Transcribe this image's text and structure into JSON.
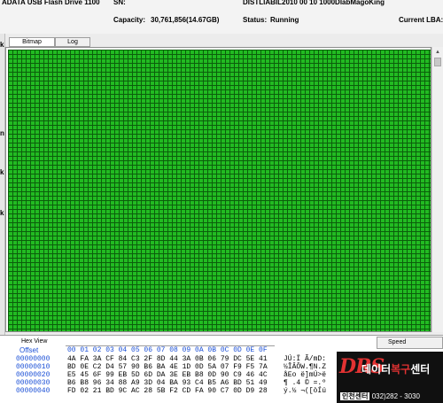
{
  "device": {
    "name": "ADATA   USB Flash Drive 1100",
    "sn_label": "SN:",
    "path_fragment": "DISTLIABIL2010 00 10 1000DlabMagoKing",
    "capacity_label": "Capacity:",
    "capacity_value": "30,761,856(14.67GB)",
    "status_label": "Status:",
    "status_value": "Running",
    "lba_label": "Current LBA:"
  },
  "left_strip": [
    "k",
    "",
    "n",
    "k",
    "k"
  ],
  "tabs": [
    {
      "label": "Bitmap"
    },
    {
      "label": "Log"
    }
  ],
  "hex_view": {
    "title": "Hex View",
    "offset_header": "Offset",
    "column_header": "00 01 02 03 04 05 06 07 08 09 0A 0B 0C 0D 0E 0F",
    "rows": [
      {
        "offset": "00000000",
        "bytes": "4A FA 3A CF 84 C3 2F 8D 44 3A 0B 06 79 DC 5E 41",
        "ascii": "JÚ:Ï Ã/mD:"
      },
      {
        "offset": "00000010",
        "bytes": "BD 0E C2 D4 57 90 B6 BA 4E 1D 0D 5A 07 F9 F5 7A",
        "ascii": "½ÎÂÔW.¶N.Z"
      },
      {
        "offset": "00000020",
        "bytes": "E5 45 6F 99 EB 5D 6D DA 3E EB B8 0D 90 C9 46 4C",
        "ascii": "åEo ë]mÚ>ë"
      },
      {
        "offset": "00000030",
        "bytes": "B6 B8 96 34 88 A9 3D 04 BA 93 C4 B5 A6 BD 51 49",
        "ascii": "¶ .4 © =.º"
      },
      {
        "offset": "00000040",
        "bytes": "FD 02 21 BD 9C AC 28 5B F2 CD FA 90 C7 0D D9 28",
        "ascii": "ý.½ ¬([òÍú"
      }
    ]
  },
  "speed_label": "Speed",
  "banner": {
    "logo": "DRS",
    "title_white": "데이터",
    "title_red": "복구",
    "title_white2": "센터",
    "tag": "인천센터",
    "phone": "032)282 - 3030"
  },
  "colors": {
    "bitmap_cell": "#22bb22",
    "bitmap_cell_border": "#0c5e0c",
    "hex_header_blue": "#1a4fd6",
    "banner_red": "#e23232"
  }
}
